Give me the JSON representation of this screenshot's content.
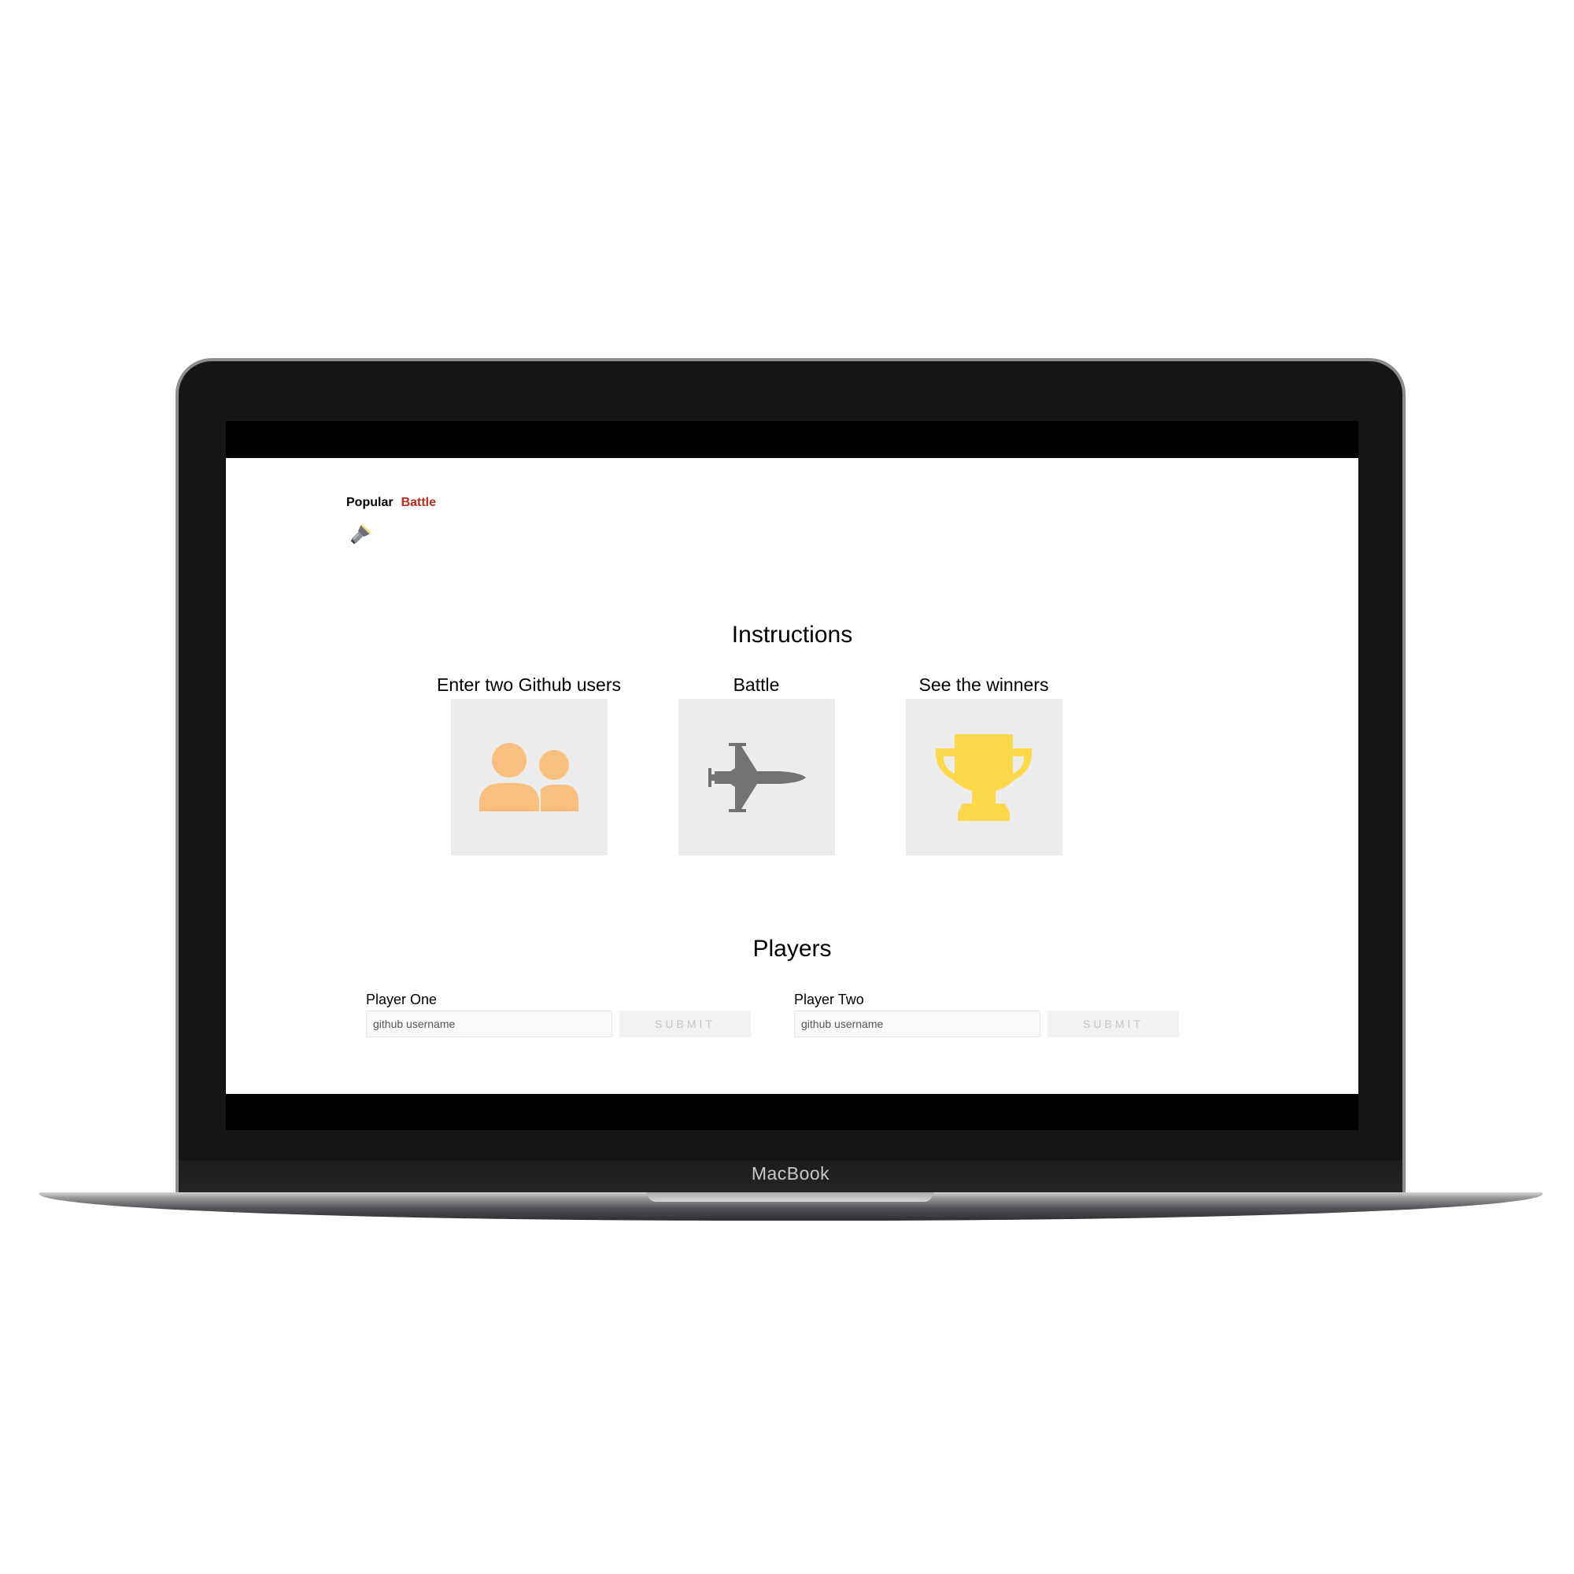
{
  "device": {
    "brand": "MacBook"
  },
  "nav": {
    "items": [
      {
        "label": "Popular",
        "active": false
      },
      {
        "label": "Battle",
        "active": true
      }
    ],
    "active_color": "#bb2b1f",
    "theme_icon": "flashlight-icon"
  },
  "instructions": {
    "title": "Instructions",
    "steps": [
      {
        "label": "Enter two Github users",
        "icon": "users-icon",
        "icon_color": "#f9bf7f"
      },
      {
        "label": "Battle",
        "icon": "fighter-jet-icon",
        "icon_color": "#727272"
      },
      {
        "label": "See the winners",
        "icon": "trophy-icon",
        "icon_color": "#fcd94a"
      }
    ]
  },
  "players": {
    "title": "Players",
    "player_one": {
      "label": "Player One",
      "placeholder": "github username",
      "value": "",
      "submit_label": "SUBMIT"
    },
    "player_two": {
      "label": "Player Two",
      "placeholder": "github username",
      "value": "",
      "submit_label": "SUBMIT"
    }
  }
}
